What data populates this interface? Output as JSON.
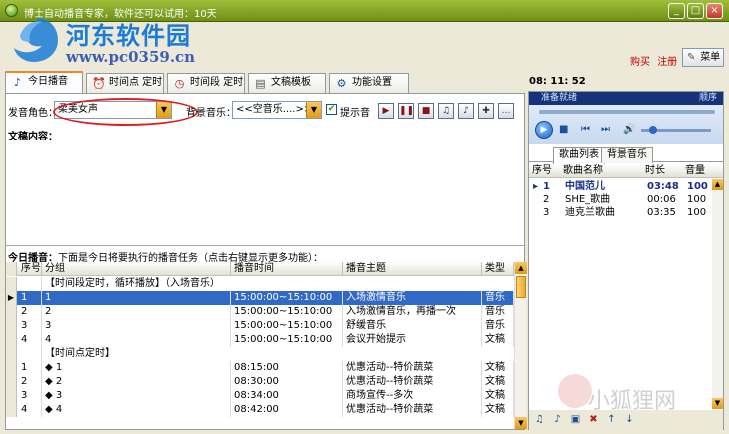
{
  "window": {
    "title": "博士自动播音专家，软件还可以试用：10天",
    "minimize": "_",
    "maximize": "□",
    "close": "×"
  },
  "logo": {
    "name": "河东软件园",
    "url": "www.pc0359.cn"
  },
  "header": {
    "buy": "购买",
    "register": "注册",
    "menu": "菜单"
  },
  "clock": "08: 11: 52",
  "tabs": [
    {
      "label": "今日播音",
      "icon": "speaker-icon",
      "active": true
    },
    {
      "label": "时间点 定时",
      "icon": "alarm-clock-icon",
      "active": false
    },
    {
      "label": "时间段 定时",
      "icon": "clock-icon",
      "active": false
    },
    {
      "label": "文稿模板",
      "icon": "document-icon",
      "active": false
    },
    {
      "label": "功能设置",
      "icon": "gear-icon",
      "active": false
    }
  ],
  "controls": {
    "voice_label": "发音角色：",
    "voice_value": "柔美女声",
    "bgm_label": "背景音乐：",
    "bgm_value": "<<空音乐....>>",
    "prompt_label": "提示音",
    "prompt_checked": true
  },
  "content_label": "文稿内容：",
  "today": {
    "label": "今日播音：",
    "hint": "下面是今日将要执行的播音任务（点击右键显示更多功能）："
  },
  "table": {
    "columns": [
      "序号",
      "分组",
      "播音时间",
      "播音主题",
      "类型"
    ],
    "rows": [
      {
        "group": "【时间段定时，循环播放】（入场音乐）"
      },
      {
        "no": "1",
        "name": "1",
        "time": "15:00:00~15:10:00",
        "topic": "入场激情音乐",
        "type": "音乐",
        "selected": true
      },
      {
        "no": "2",
        "name": "2",
        "time": "15:00:00~15:10:00",
        "topic": "入场激情音乐，再播一次",
        "type": "音乐"
      },
      {
        "no": "3",
        "name": "3",
        "time": "15:00:00~15:10:00",
        "topic": "舒缓音乐",
        "type": "音乐"
      },
      {
        "no": "4",
        "name": "4",
        "time": "15:00:00~15:10:00",
        "topic": "会议开始提示",
        "type": "文稿"
      },
      {
        "group": "【时间点定时】"
      },
      {
        "no": "1",
        "name": "◆ 1",
        "time": "08:15:00",
        "topic": "优惠活动--特价蔬菜",
        "type": "文稿"
      },
      {
        "no": "2",
        "name": "◆ 2",
        "time": "08:30:00",
        "topic": "优惠活动--特价蔬菜",
        "type": "文稿"
      },
      {
        "no": "3",
        "name": "◆ 3",
        "time": "08:34:00",
        "topic": "商场宣传--多次",
        "type": "文稿"
      },
      {
        "no": "4",
        "name": "◆ 4",
        "time": "08:42:00",
        "topic": "优惠活动--特价蔬菜",
        "type": "文稿"
      }
    ]
  },
  "player": {
    "status": "准备就绪",
    "mode": "顺序"
  },
  "right_tabs": [
    "歌曲列表",
    "背景音乐"
  ],
  "song_list": {
    "columns": [
      "序号",
      "歌曲名称",
      "时长",
      "音量"
    ],
    "rows": [
      {
        "no": "1",
        "name": "中国范儿",
        "duration": "03:48",
        "volume": "100",
        "playing": true
      },
      {
        "no": "2",
        "name": "SHE_歌曲",
        "duration": "00:06",
        "volume": "100"
      },
      {
        "no": "3",
        "name": "迪克兰歌曲",
        "duration": "03:35",
        "volume": "100"
      }
    ]
  },
  "watermark": "小狐狸网"
}
